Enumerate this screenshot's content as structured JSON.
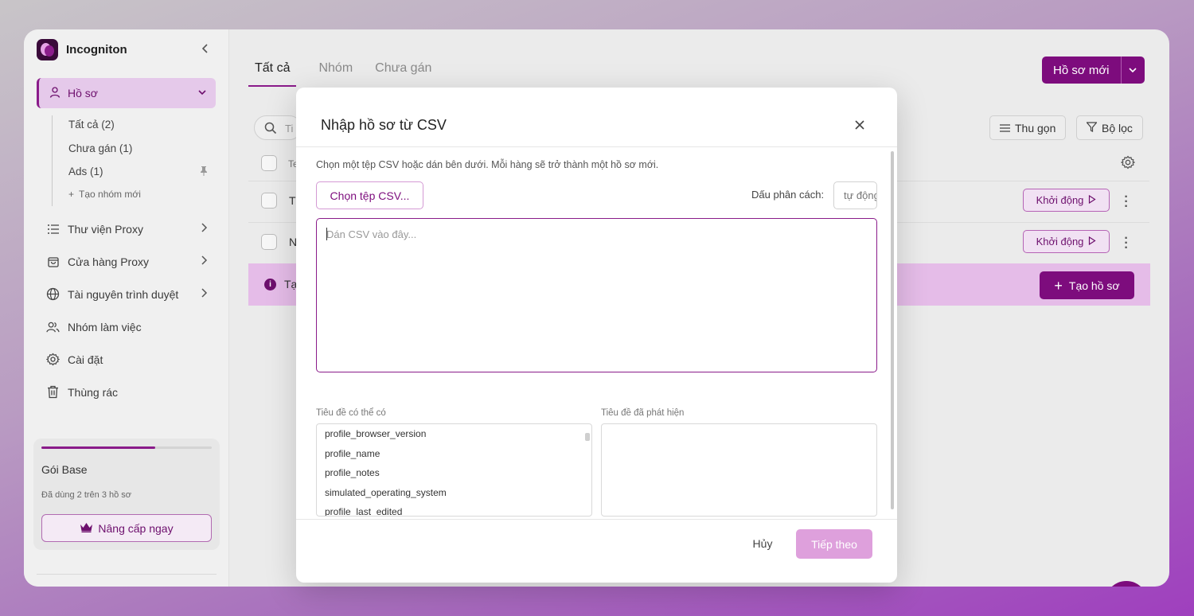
{
  "app": {
    "name": "Incogniton"
  },
  "sidebar": {
    "active_item": {
      "label": "Hồ sơ"
    },
    "groups": [
      {
        "label": "Tất cả (2)"
      },
      {
        "label": "Chưa gán (1)"
      },
      {
        "label": "Ads (1)"
      },
      {
        "label": "Tạo nhóm mới"
      }
    ],
    "items": [
      {
        "label": "Thư viện Proxy",
        "icon": "list-icon"
      },
      {
        "label": "Cửa hàng Proxy",
        "icon": "shopping-bag-icon"
      },
      {
        "label": "Tài nguyên trình duyệt",
        "icon": "globe-icon"
      },
      {
        "label": "Nhóm làm việc",
        "icon": "users-icon"
      },
      {
        "label": "Cài đặt",
        "icon": "gear-icon"
      },
      {
        "label": "Thùng rác",
        "icon": "trash-icon"
      }
    ],
    "plan": {
      "title": "Gói Base",
      "usage": "Đã dùng 2 trên 3 hồ sơ",
      "progress": 0.67,
      "upgrade_label": "Nâng cấp ngay"
    }
  },
  "main": {
    "tabs": [
      {
        "label": "Tất cả"
      },
      {
        "label": "Nhóm"
      },
      {
        "label": "Chưa gán"
      }
    ],
    "new_profile_label": "Hồ sơ mới",
    "collapse_label": "Thu gọn",
    "filter_label": "Bộ lọc",
    "search_visible_text": "Ti",
    "header_cell_text": "Te",
    "rows": [
      {
        "name_visible": "T",
        "launch_label": "Khởi động"
      },
      {
        "name_visible": "N",
        "launch_label": "Khởi động"
      }
    ],
    "info_banner": {
      "text_visible": "Tạ",
      "create_label": "Tạo hồ sơ"
    }
  },
  "modal": {
    "title": "Nhập hồ sơ từ CSV",
    "description": "Chọn một tệp CSV hoặc dán bên dưới. Mỗi hàng sẽ trở thành một hồ sơ mới.",
    "choose_file_label": "Chọn tệp CSV...",
    "delimiter_label": "Dấu phân cách:",
    "delimiter_placeholder": "tự động",
    "csv_placeholder": "Dán CSV vào đây...",
    "possible_headers_label": "Tiêu đề có thể có",
    "detected_headers_label": "Tiêu đề đã phát hiện",
    "possible_headers": [
      "profile_browser_version",
      "profile_name",
      "profile_notes",
      "simulated_operating_system",
      "profile_last_edited"
    ],
    "cancel_label": "Hủy",
    "next_label": "Tiếp theo"
  },
  "colors": {
    "accent": "#7d0c7d",
    "accent_light": "#e5c9ea",
    "next_disabled": "#dea0dc"
  }
}
